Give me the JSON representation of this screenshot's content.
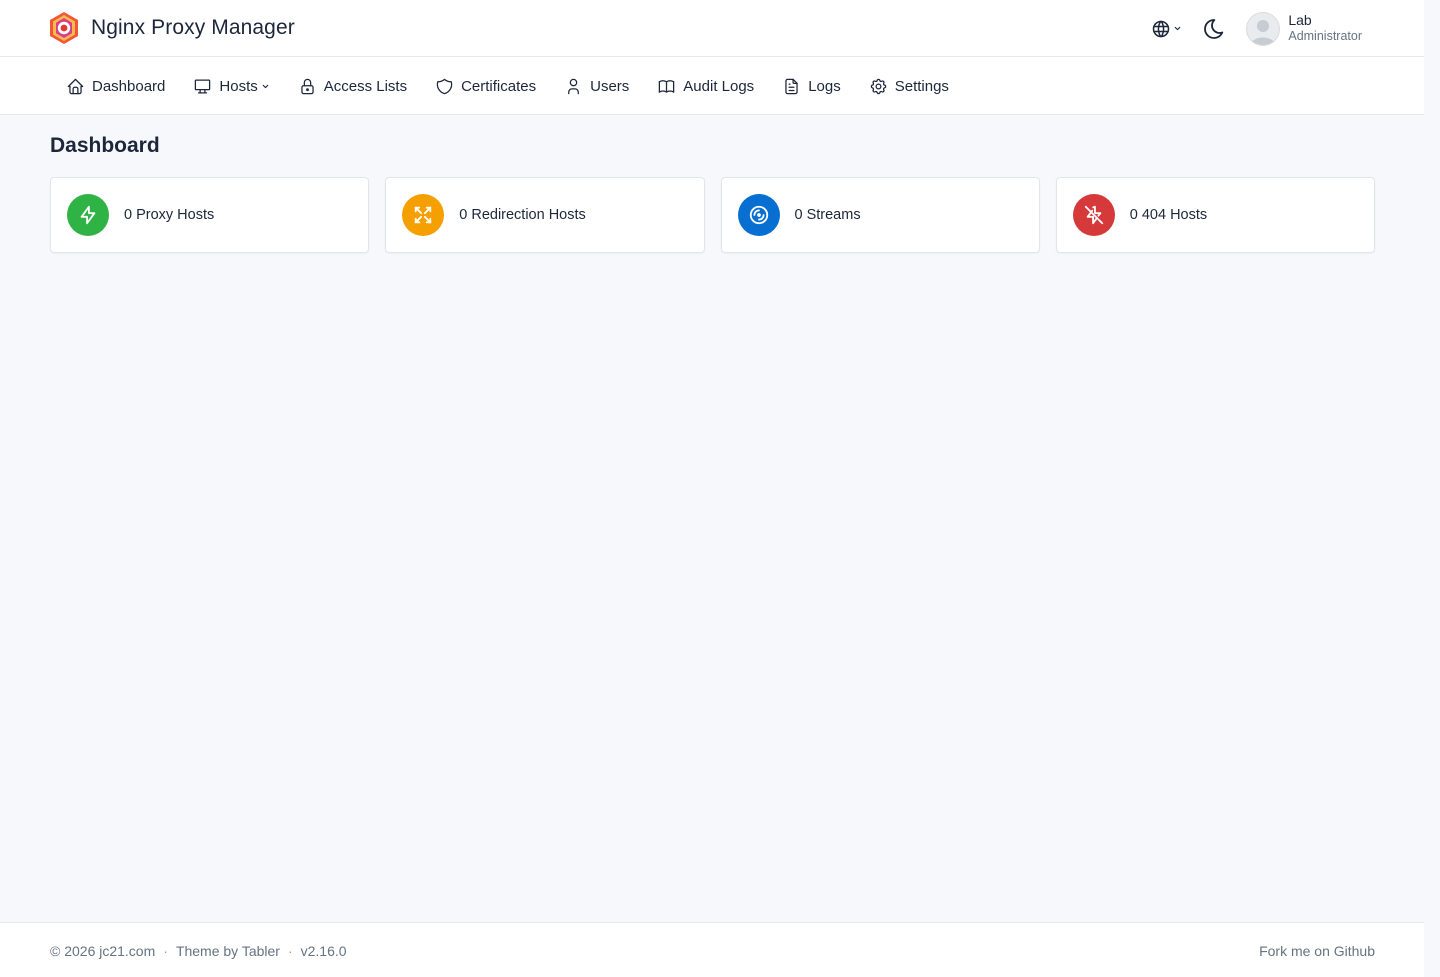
{
  "app": {
    "title": "Nginx Proxy Manager"
  },
  "user": {
    "name": "Lab",
    "role": "Administrator"
  },
  "nav": {
    "items": [
      {
        "label": "Dashboard",
        "icon": "home-icon"
      },
      {
        "label": "Hosts",
        "icon": "monitor-icon",
        "has_dropdown": true
      },
      {
        "label": "Access Lists",
        "icon": "lock-icon"
      },
      {
        "label": "Certificates",
        "icon": "shield-icon"
      },
      {
        "label": "Users",
        "icon": "user-icon"
      },
      {
        "label": "Audit Logs",
        "icon": "book-icon"
      },
      {
        "label": "Logs",
        "icon": "file-text-icon"
      },
      {
        "label": "Settings",
        "icon": "gear-icon"
      }
    ]
  },
  "main": {
    "page_title": "Dashboard",
    "cards": [
      {
        "label": "0 Proxy Hosts",
        "icon": "bolt-icon",
        "color": "#2fb344"
      },
      {
        "label": "0 Redirection Hosts",
        "icon": "arrows-cross-icon",
        "color": "#f59f00"
      },
      {
        "label": "0 Streams",
        "icon": "disc-icon",
        "color": "#066fd1"
      },
      {
        "label": "0 404 Hosts",
        "icon": "bolt-off-icon",
        "color": "#d63939"
      }
    ]
  },
  "footer": {
    "copyright": "© 2026 jc21.com",
    "theme": "Theme by Tabler",
    "version": "v2.16.0",
    "github": "Fork me on Github"
  }
}
